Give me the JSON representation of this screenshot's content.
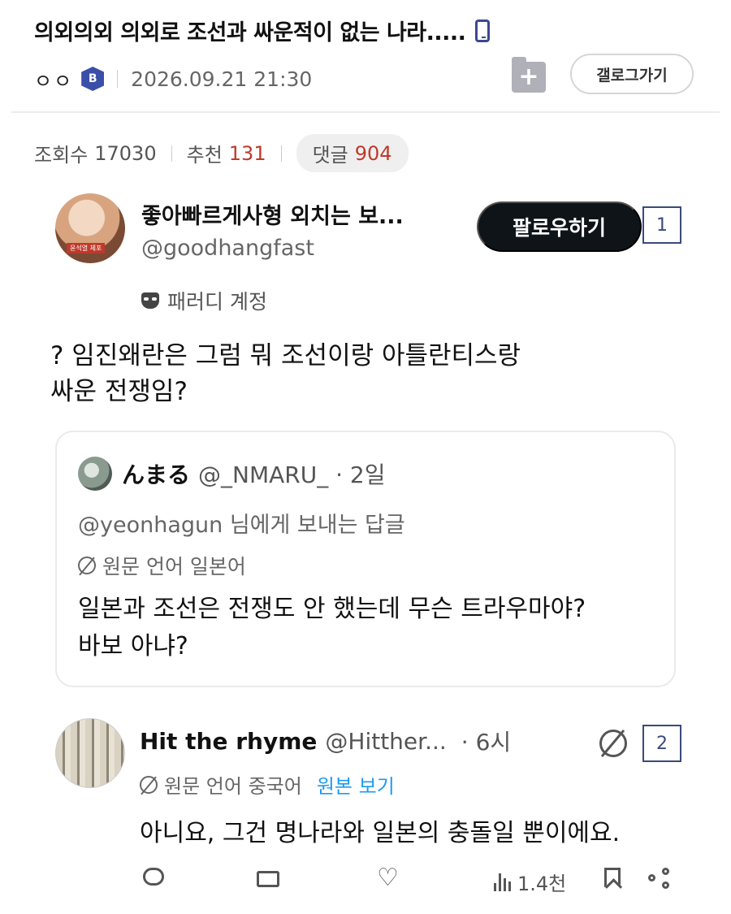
{
  "post": {
    "title": "의외의외 의외로 조선과 싸운적이 없는 나라.....",
    "author_nick": "ㅇㅇ",
    "badge": "B",
    "date": "2026.09.21 21:30",
    "gallery_button": "갤로그가기",
    "views_label": "조회수",
    "views": "17030",
    "recommend_label": "추천",
    "recommend": "131",
    "comments_label": "댓글",
    "comments": "904"
  },
  "tweet": {
    "name": "좋아빠르게사형 외치는 보...",
    "handle": "@goodhangfast",
    "avatar_caption": "윤석열 체포",
    "parody_label": "패러디 계정",
    "follow_label": "팔로우하기",
    "marker_1": "1",
    "text_line1": "? 임진왜란은 그럼 뭐 조선이랑 아틀란티스랑",
    "text_line2": "싸운 전쟁임?"
  },
  "quote": {
    "name": "んまる",
    "handle": "@_NMARU_ · 2일",
    "reply_to": "@yeonhagun 님에게 보내는 답글",
    "lang": "원문 언어 일본어",
    "body_line1": "일본과 조선은 전쟁도 안 했는데 무슨 트라우마야?",
    "body_line2": "바보 아냐?"
  },
  "reply": {
    "name": "Hit the rhyme",
    "handle": "@Hitther...",
    "time": "· 6시",
    "marker_2": "2",
    "lang": "원문 언어 중국어",
    "show_original": "원본 보기",
    "body": "아니요, 그건 명나라와 일본의 충돌일 뿐이에요.",
    "views": "1.4천"
  },
  "colors": {
    "accent_red": "#c0392b",
    "link_blue": "#1d9bf0",
    "badge_blue": "#3b4fa8",
    "follow_black": "#0f1419"
  },
  "icons": [
    "phone-icon",
    "add-gallery-icon",
    "mask-icon",
    "translate-icon",
    "reply-icon",
    "retweet-icon",
    "like-icon",
    "views-icon",
    "bookmark-icon",
    "share-icon"
  ]
}
